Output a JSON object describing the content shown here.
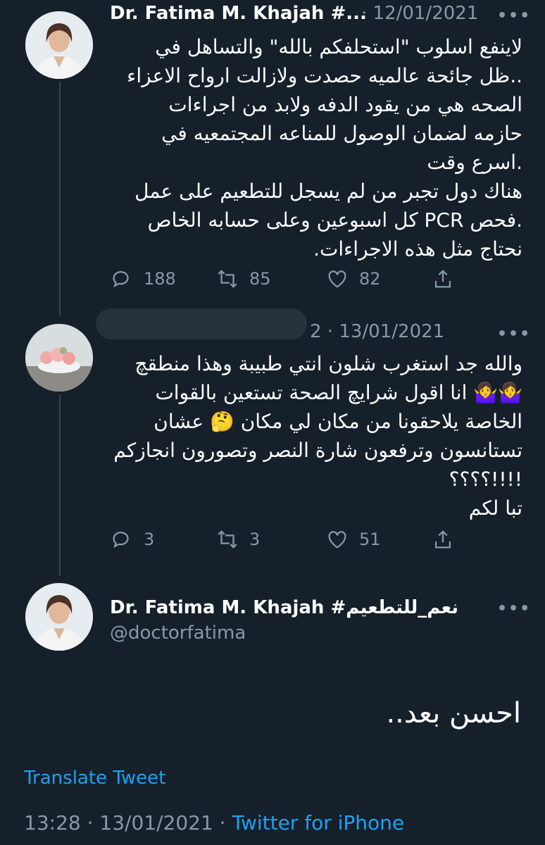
{
  "tweets": [
    {
      "name": "Dr. Fatima M. Khajah #...",
      "date": "· 12/01/2021",
      "text": "لاينفع اسلوب \"استحلفكم بالله\" والتساهل في\n..ظل جائحة عالميه حصدت ولازالت ارواح الاعزاء\nالصحه هي من يقود الدفه ولابد من اجراءات\nحازمه لضمان الوصول للمناعه المجتمعيه في\n.اسرع وقت\nهناك دول تجبر من لم يسجل للتطعيم على عمل\n.فحص PCR كل اسبوعين وعلى حسابه الخاص\nنحتاج مثل هذه الاجراءات.",
      "replies": "188",
      "retweets": "85",
      "likes": "82"
    },
    {
      "name_suffix": "2 · 13/01/2021",
      "text": "والله جد استغرب شلون انتي طبيبة وهذا منطقچ\n🤷‍♀️🤷‍♀️ انا اقول شرايچ الصحة تستعين بالقوات\nالخاصة يلاحقونا من مكان لي مكان 🤔 عشان\nتستانسون وترفعون شارة النصر وتصورون انجازكم\n!!!!؟؟؟؟\nتبا لكم",
      "replies": "3",
      "retweets": "3",
      "likes": "51"
    }
  ],
  "main": {
    "name": "Dr. Fatima M. Khajah #نعم_للتطعيم",
    "handle": "@doctorfatima",
    "text": "احسن بعد..",
    "translate": "Translate Tweet",
    "time": "13:28 · 13/01/2021 · ",
    "source": "Twitter for iPhone"
  },
  "icons": {
    "more": "more-dots-icon",
    "reply": "reply-icon",
    "retweet": "retweet-icon",
    "like": "heart-icon",
    "share": "share-icon"
  },
  "colors": {
    "background": "#15202b",
    "muted": "#8899a6",
    "link": "#1da1f2"
  }
}
